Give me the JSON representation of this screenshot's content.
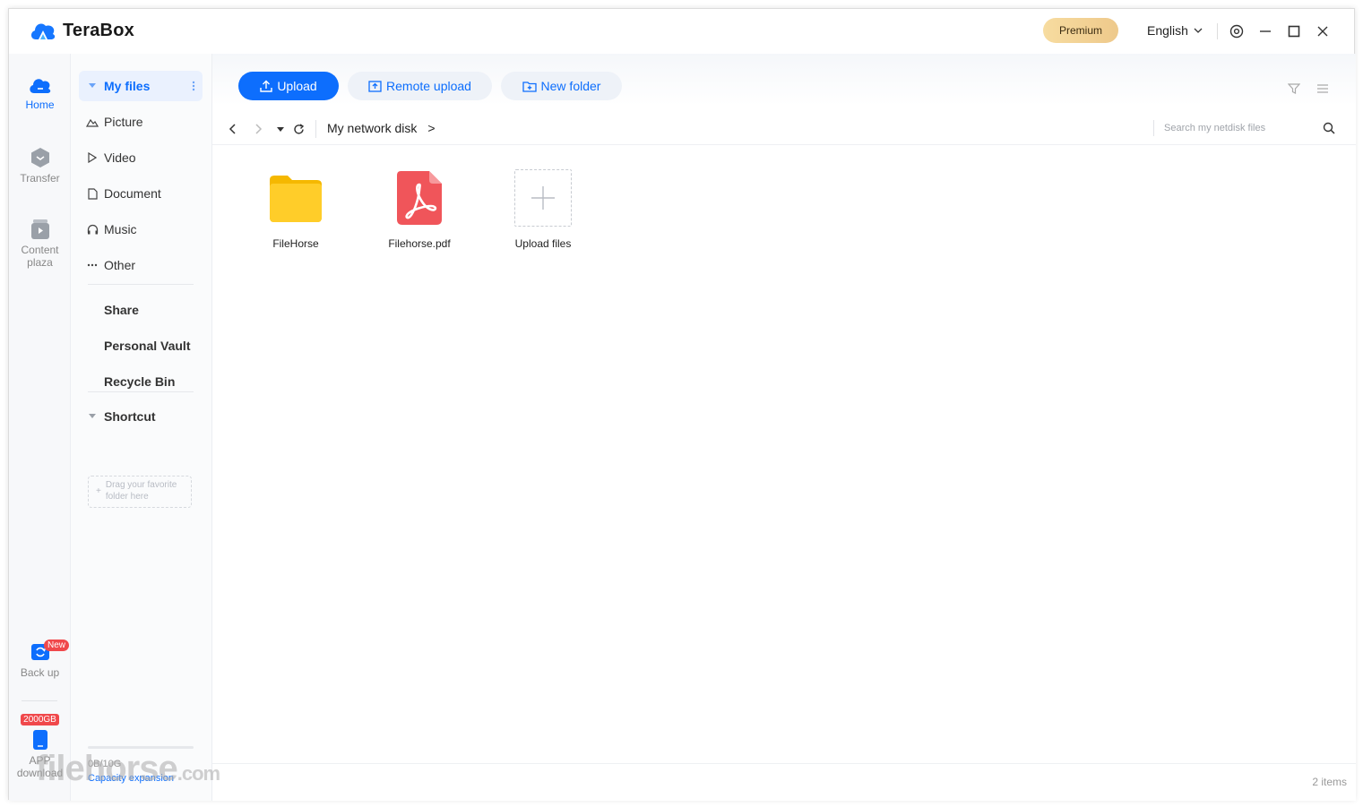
{
  "app": {
    "name": "TeraBox"
  },
  "titlebar": {
    "premium_label": "Premium",
    "language": "English"
  },
  "rail": {
    "home": "Home",
    "transfer": "Transfer",
    "content_line1": "Content",
    "content_line2": "plaza",
    "backup": "Back up",
    "backup_badge": "New",
    "capacity_badge": "2000GB",
    "app_line1": "APP",
    "app_line2": "download"
  },
  "sidebar": {
    "my_files": "My files",
    "items": [
      "Picture",
      "Video",
      "Document",
      "Music",
      "Other"
    ],
    "share": "Share",
    "vault": "Personal Vault",
    "recycle": "Recycle Bin",
    "shortcut": "Shortcut",
    "drop_hint_line1": "Drag your favorite",
    "drop_hint_line2": "folder here",
    "storage": "0B/10G",
    "capacity_link": "Capacity expansion"
  },
  "toolbar": {
    "upload": "Upload",
    "remote_upload": "Remote upload",
    "new_folder": "New folder"
  },
  "nav": {
    "path_root": "My network disk",
    "path_sep": ">",
    "search_placeholder": "Search my netdisk files"
  },
  "files": [
    {
      "name": "FileHorse",
      "type": "folder"
    },
    {
      "name": "Filehorse.pdf",
      "type": "pdf"
    }
  ],
  "upload_tile": {
    "label": "Upload files"
  },
  "status": {
    "count": "2 items"
  },
  "watermark": {
    "main": "filehorse",
    "suffix": ".com"
  },
  "colors": {
    "accent": "#0d6efd",
    "folder": "#ffc81e",
    "pdf": "#f0555a",
    "premium": "#f1d199"
  }
}
